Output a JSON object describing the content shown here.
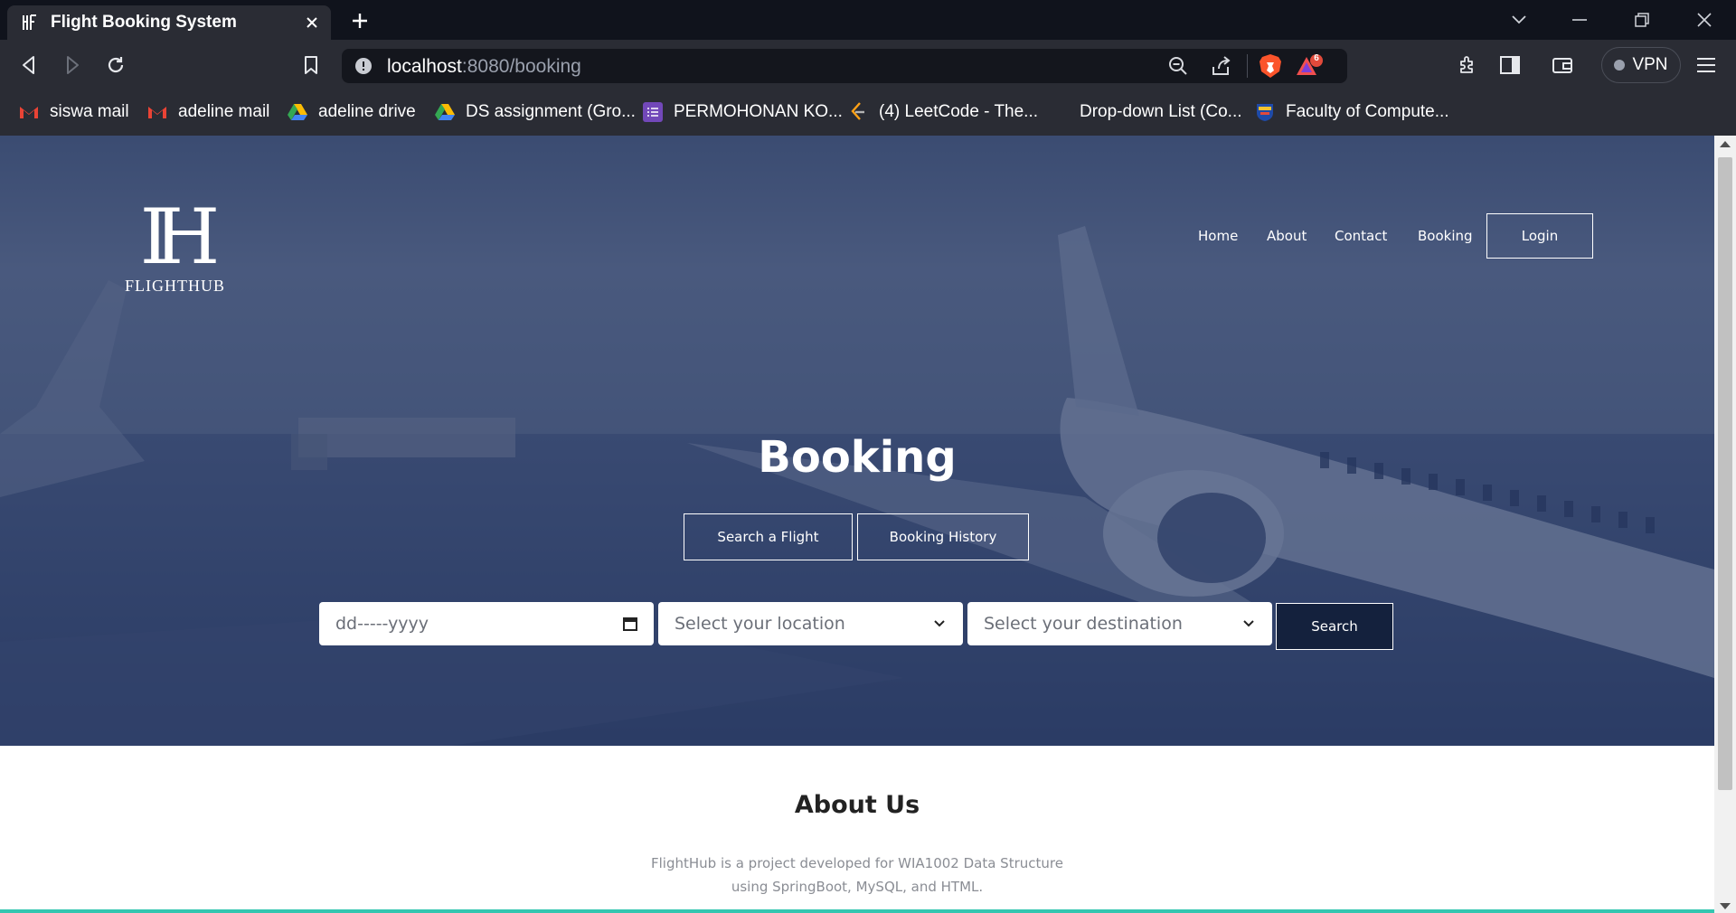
{
  "browser": {
    "tab_title": "Flight Booking System",
    "url_host": "localhost",
    "url_path": ":8080/booking",
    "vpn_label": "VPN",
    "notification_count": "6",
    "bookmarks": [
      {
        "label": "siswa mail",
        "icon": "gmail-icon"
      },
      {
        "label": "adeline mail",
        "icon": "gmail-icon"
      },
      {
        "label": "adeline drive",
        "icon": "google-drive-icon"
      },
      {
        "label": "DS assignment (Gro...",
        "icon": "google-drive-icon"
      },
      {
        "label": "PERMOHONAN KO...",
        "icon": "google-forms-icon"
      },
      {
        "label": "(4) LeetCode - The...",
        "icon": "leetcode-icon"
      },
      {
        "label": "Drop-down List (Co...",
        "icon": "blank-page-icon"
      },
      {
        "label": "Faculty of Compute...",
        "icon": "university-crest-icon"
      }
    ]
  },
  "site": {
    "logo_text": "FLIGHTHUB",
    "nav": {
      "home": "Home",
      "about": "About",
      "contact": "Contact",
      "booking": "Booking",
      "login": "Login"
    },
    "hero_title": "Booking",
    "buttons": {
      "search_flight": "Search a Flight",
      "booking_history": "Booking History",
      "search": "Search"
    },
    "form": {
      "date_placeholder": "dd-----yyyy",
      "location_placeholder": "Select your location",
      "destination_placeholder": "Select your destination"
    },
    "about": {
      "title": "About Us",
      "line1": "FlightHub is a project developed for WIA1002 Data Structure",
      "line2": "using SpringBoot, MySQL, and HTML."
    }
  },
  "colors": {
    "hero_overlay": "#3b4c72",
    "search_button_bg": "#14213d",
    "browser_dark": "#10131c",
    "browser_toolbar": "#2a2c34",
    "accent_line": "#34c6b0"
  }
}
